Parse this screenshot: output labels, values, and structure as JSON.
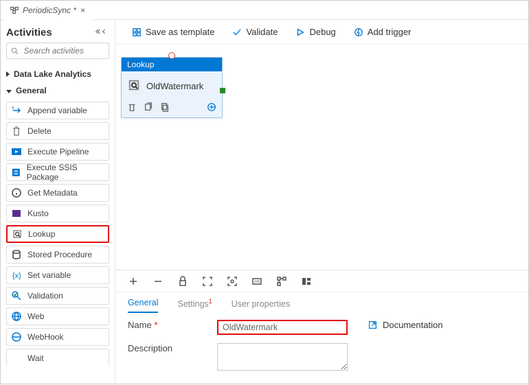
{
  "tab": {
    "title": "PeriodicSync *",
    "close": "×"
  },
  "sidebar": {
    "title": "Activities",
    "search_placeholder": "Search activities",
    "groups": {
      "g0": {
        "label": "Data Lake Analytics"
      },
      "g1": {
        "label": "General",
        "items": [
          {
            "label": "Append variable"
          },
          {
            "label": "Delete"
          },
          {
            "label": "Execute Pipeline"
          },
          {
            "label": "Execute SSIS Package"
          },
          {
            "label": "Get Metadata"
          },
          {
            "label": "Kusto"
          },
          {
            "label": "Lookup"
          },
          {
            "label": "Stored Procedure"
          },
          {
            "label": "Set variable"
          },
          {
            "label": "Validation"
          },
          {
            "label": "Web"
          },
          {
            "label": "WebHook"
          },
          {
            "label": "Wait"
          }
        ]
      }
    }
  },
  "canvas_toolbar": {
    "save": "Save as template",
    "validate": "Validate",
    "debug": "Debug",
    "trigger": "Add trigger"
  },
  "node": {
    "type": "Lookup",
    "name": "OldWatermark"
  },
  "panel": {
    "tabs": {
      "general": "General",
      "settings": "Settings",
      "user": "User properties"
    },
    "name_label": "Name",
    "name_value": "OldWatermark",
    "desc_label": "Description",
    "desc_value": "",
    "documentation": "Documentation"
  }
}
